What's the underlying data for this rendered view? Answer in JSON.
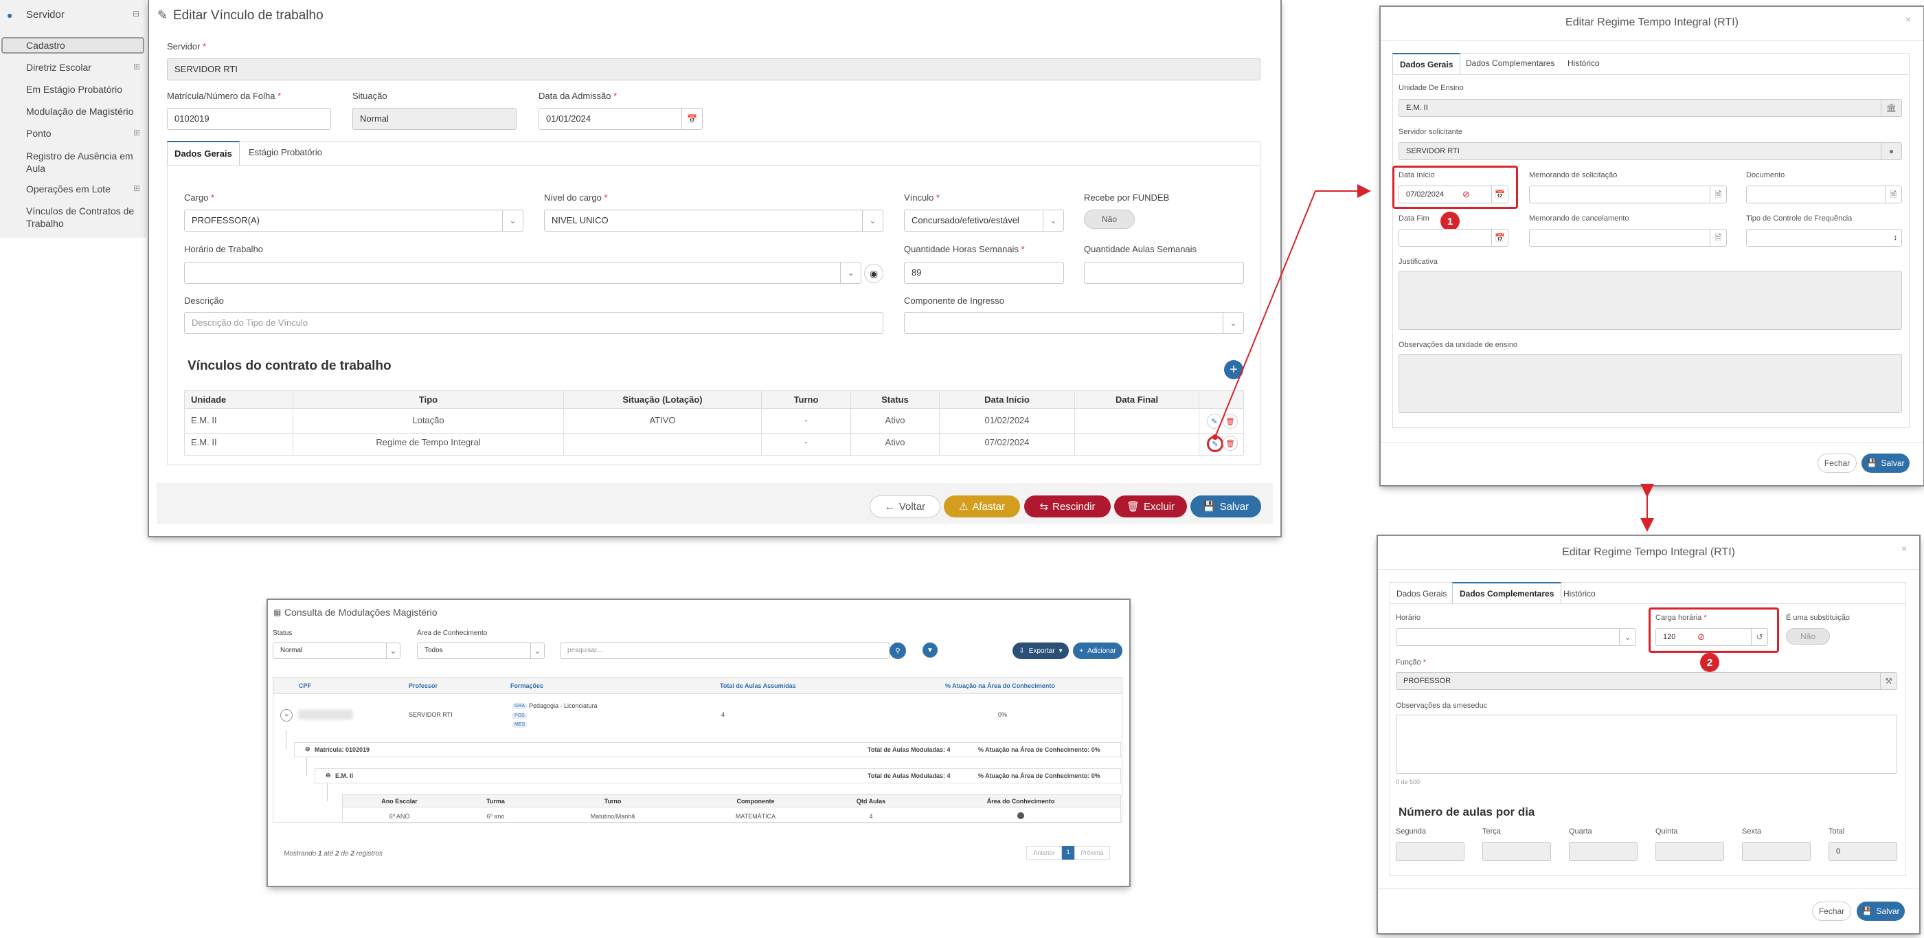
{
  "sidebar": {
    "header": "Servidor",
    "items": [
      {
        "label": "Cadastro"
      },
      {
        "label": "Diretriz Escolar"
      },
      {
        "label": "Em Estágio Probatório"
      },
      {
        "label": "Modulação de Magistério"
      },
      {
        "label": "Ponto"
      },
      {
        "label": "Registro de Ausência em Aula"
      },
      {
        "label": "Operações em Lote"
      },
      {
        "label": "Vínculos de Contratos de Trabalho"
      }
    ]
  },
  "main": {
    "title": "Editar Vínculo de trabalho",
    "servidor_label": "Servidor",
    "servidor_value": "SERVIDOR RTI",
    "matricula_label": "Matrícula/Número da Folha",
    "matricula_value": "0102019",
    "situacao_label": "Situação",
    "situacao_value": "Normal",
    "admissao_label": "Data da Admissão",
    "admissao_value": "01/01/2024",
    "tabs": [
      {
        "label": "Dados Gerais"
      },
      {
        "label": "Estágio Probatório"
      }
    ],
    "cargo_label": "Cargo",
    "cargo_value": "PROFESSOR(A)",
    "nivel_label": "Nível do cargo",
    "nivel_value": "NIVEL UNICO",
    "vinculo_label": "Vínculo",
    "vinculo_value": "Concursado/efetivo/estável",
    "fundeb_label": "Recebe por FUNDEB",
    "fundeb_value": "Não",
    "horario_label": "Horário de Trabalho",
    "qhs_label": "Quantidade Horas Semanais",
    "qhs_value": "89",
    "qas_label": "Quantidade Aulas Semanais",
    "descricao_label": "Descrição",
    "descricao_placeholder": "Descrição do Tipo de Vínculo",
    "componente_label": "Componente de Ingresso",
    "vinculos_title": "Vínculos do contrato de trabalho",
    "table_headers": [
      "Unidade",
      "Tipo",
      "Situação (Lotação)",
      "Turno",
      "Status",
      "Data Início",
      "Data Final"
    ],
    "rows": [
      [
        "E.M. II",
        "Lotação",
        "ATIVO",
        "-",
        "Ativo",
        "01/02/2024",
        ""
      ],
      [
        "E.M. II",
        "Regime de Tempo Integral",
        "",
        "-",
        "Ativo",
        "07/02/2024",
        ""
      ]
    ],
    "buttons": {
      "voltar": "Voltar",
      "afastar": "Afastar",
      "rescindir": "Rescindir",
      "excluir": "Excluir",
      "salvar": "Salvar"
    }
  },
  "modal1": {
    "title": "Editar Regime Tempo Integral (RTI)",
    "tabs": [
      {
        "label": "Dados Gerais"
      },
      {
        "label": "Dados Complementares"
      },
      {
        "label": "Histórico"
      }
    ],
    "unidade_label": "Unidade De Ensino",
    "unidade_value": "E.M. II",
    "servidor_label": "Servidor solicitante",
    "servidor_value": "SERVIDOR RTI",
    "data_inicio_label": "Data Início",
    "data_inicio_value": "07/02/2024",
    "memorando_sol_label": "Memorando de solicitação",
    "documento_label": "Documento",
    "data_fim_label": "Data Fim",
    "memorando_canc_label": "Memorando de cancelamento",
    "tipo_controle_label": "Tipo de Controle de Frequência",
    "justificativa_label": "Justificativa",
    "observacoes_label": "Observações da unidade de ensino",
    "badge": "1",
    "fechar": "Fechar",
    "salvar": "Salvar"
  },
  "modal2": {
    "title": "Editar Regime Tempo Integral (RTI)",
    "tabs": [
      {
        "label": "Dados Gerais"
      },
      {
        "label": "Dados Complementares"
      },
      {
        "label": "Histórico"
      }
    ],
    "horario_label": "Horário",
    "carga_label": "Carga horária",
    "carga_value": "120",
    "substituicao_label": "É uma substituição",
    "substituicao_value": "Não",
    "funcao_label": "Função",
    "funcao_value": "PROFESSOR",
    "obs_label": "Observações da smeseduc",
    "counter": "0 de 500",
    "aulas_title": "Número de aulas por dia",
    "days": [
      "Segunda",
      "Terça",
      "Quarta",
      "Quinta",
      "Sexta",
      "Total"
    ],
    "total_value": "0",
    "badge": "2",
    "fechar": "Fechar",
    "salvar": "Salvar"
  },
  "consulta": {
    "title": "Consulta de Modulações Magistério",
    "status_label": "Status",
    "status_value": "Normal",
    "area_label": "Área de Conhecimento",
    "area_value": "Todos",
    "search_placeholder": "pesquisar...",
    "exportar": "Exportar",
    "adicionar": "Adicionar",
    "headers": [
      "CPF",
      "Professor",
      "Formações",
      "Total de Aulas Assumidas",
      "% Atuação na Área do Conhecimento"
    ],
    "row": {
      "professor": "SERVIDOR RTI",
      "formacao": "Pedagogia - Licenciatura",
      "tags": [
        "GRA",
        "POS",
        "MES"
      ],
      "total": "4",
      "atuacao": "0%"
    },
    "matricula": "Matrícula: 0102019",
    "mat_total": "Total de Aulas Moduladas: 4",
    "mat_atuacao": "% Atuação na Área de Conhecimento: 0%",
    "escola": "E.M. II",
    "esc_total": "Total de Aulas Moduladas: 4",
    "esc_atuacao": "% Atuação na Área de Conhecimento: 0%",
    "sub_headers": [
      "Ano Escolar",
      "Turma",
      "Turno",
      "Componente",
      "Qtd Aulas",
      "Área do Conhecimento"
    ],
    "sub_row": [
      "6º ANO",
      "6º ano",
      "Matutino/Manhã",
      "MATEMÁTICA",
      "4"
    ],
    "footer_prefix": "Mostrando",
    "footer_from": "1",
    "footer_ate": "até",
    "footer_to": "2",
    "footer_de": "de",
    "footer_total": "2",
    "footer_suffix": "registros",
    "pager": [
      "Anterior",
      "1",
      "Próxima"
    ]
  },
  "colors": {
    "primary": "#2f6fa8",
    "warning": "#d39e1e",
    "danger": "#b0182f",
    "highlight": "#d8232a"
  }
}
